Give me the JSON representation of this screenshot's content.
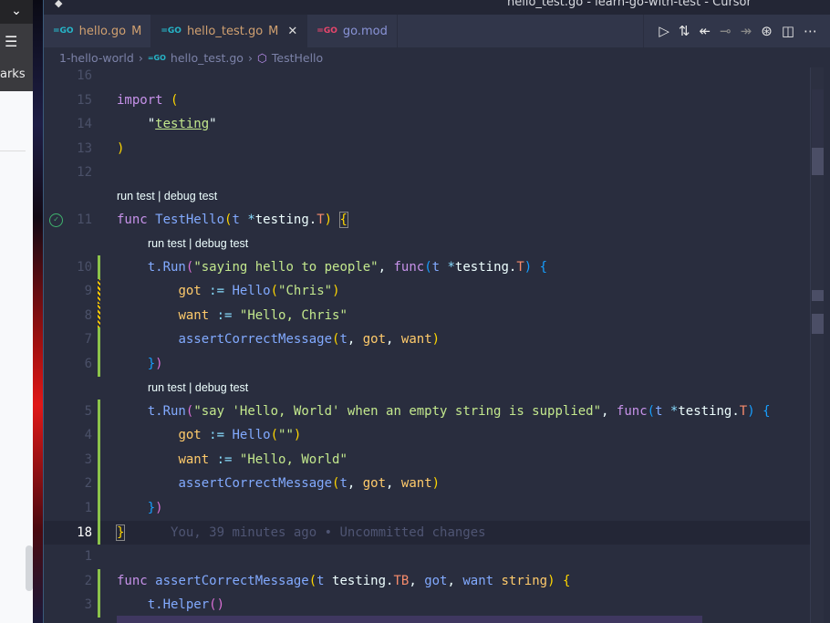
{
  "browser": {
    "label": "arks"
  },
  "window": {
    "title": "hello_test.go - learn-go-with-test - Cursor"
  },
  "tabs": [
    {
      "label": "hello.go",
      "badge": "M",
      "icon": "go-file-icon",
      "active": false
    },
    {
      "label": "hello_test.go",
      "badge": "M",
      "icon": "go-file-icon",
      "active": true
    },
    {
      "label": "go.mod",
      "badge": "",
      "icon": "go-mod-icon",
      "active": false
    }
  ],
  "actions": [
    "run-icon",
    "compare-changes-icon",
    "go-back-icon",
    "commit-icon",
    "go-forward-icon",
    "source-control-graph-icon",
    "split-editor-icon",
    "more-icon"
  ],
  "breadcrumbs": {
    "folder": "1-hello-world",
    "file": "hello_test.go",
    "symbol": "TestHello"
  },
  "lens": {
    "run": "run test",
    "sep": " | ",
    "debug": "debug test"
  },
  "blame": "You, 39 minutes ago • Uncommitted changes",
  "lines": [
    {
      "n": "16",
      "g": "",
      "t": []
    },
    {
      "n": "15",
      "g": "",
      "t": [
        [
          "kw",
          "import "
        ],
        [
          "p1",
          "("
        ]
      ]
    },
    {
      "n": "14",
      "g": "",
      "t": [
        [
          "pl",
          "    \""
        ],
        [
          "str u",
          "testing"
        ],
        [
          "pl",
          "\""
        ]
      ]
    },
    {
      "n": "13",
      "g": "",
      "t": [
        [
          "p1",
          ")"
        ]
      ]
    },
    {
      "n": "12",
      "g": "",
      "t": []
    },
    {
      "lens": true,
      "indent": 0
    },
    {
      "n": "11",
      "g": "",
      "check": true,
      "t": [
        [
          "kw",
          "func "
        ],
        [
          "fn",
          "TestHello"
        ],
        [
          "p1",
          "("
        ],
        [
          "par",
          "t "
        ],
        [
          "op",
          "*"
        ],
        [
          "pl",
          "testing."
        ],
        [
          "ty",
          "T"
        ],
        [
          "p1",
          ")"
        ],
        [
          "pl",
          " "
        ],
        [
          "p1 box",
          "{"
        ]
      ]
    },
    {
      "lens": true,
      "indent": 1
    },
    {
      "n": "10",
      "g": "add",
      "t": [
        [
          "pl",
          "    "
        ],
        [
          "fn",
          "t.Run"
        ],
        [
          "p2",
          "("
        ],
        [
          "str",
          "\"saying hello to people\""
        ],
        [
          "pl",
          ", "
        ],
        [
          "kw",
          "func"
        ],
        [
          "p3",
          "("
        ],
        [
          "par",
          "t "
        ],
        [
          "op",
          "*"
        ],
        [
          "pl",
          "testing."
        ],
        [
          "ty",
          "T"
        ],
        [
          "p3",
          ")"
        ],
        [
          "pl",
          " "
        ],
        [
          "p3",
          "{"
        ]
      ]
    },
    {
      "n": "9",
      "g": "mod",
      "t": [
        [
          "pl",
          "        "
        ],
        [
          "var",
          "got "
        ],
        [
          "op",
          ":= "
        ],
        [
          "fn",
          "Hello"
        ],
        [
          "p1",
          "("
        ],
        [
          "str",
          "\"Chris\""
        ],
        [
          "p1",
          ")"
        ]
      ]
    },
    {
      "n": "8",
      "g": "mod",
      "t": [
        [
          "pl",
          "        "
        ],
        [
          "var",
          "want "
        ],
        [
          "op",
          ":= "
        ],
        [
          "str",
          "\"Hello, Chris\""
        ]
      ]
    },
    {
      "n": "7",
      "g": "add",
      "t": [
        [
          "pl",
          "        "
        ],
        [
          "fn",
          "assertCorrectMessage"
        ],
        [
          "p1",
          "("
        ],
        [
          "par",
          "t"
        ],
        [
          "pl",
          ", "
        ],
        [
          "var",
          "got"
        ],
        [
          "pl",
          ", "
        ],
        [
          "var",
          "want"
        ],
        [
          "p1",
          ")"
        ]
      ]
    },
    {
      "n": "6",
      "g": "add",
      "t": [
        [
          "pl",
          "    "
        ],
        [
          "p3",
          "}"
        ],
        [
          "p2",
          ")"
        ]
      ]
    },
    {
      "lens": true,
      "indent": 1
    },
    {
      "n": "5",
      "g": "add",
      "t": [
        [
          "pl",
          "    "
        ],
        [
          "fn",
          "t.Run"
        ],
        [
          "p2",
          "("
        ],
        [
          "str",
          "\"say 'Hello, World' when an empty string is supplied\""
        ],
        [
          "pl",
          ", "
        ],
        [
          "kw",
          "func"
        ],
        [
          "p3",
          "("
        ],
        [
          "par",
          "t "
        ],
        [
          "op",
          "*"
        ],
        [
          "pl",
          "testing."
        ],
        [
          "ty",
          "T"
        ],
        [
          "p3",
          ")"
        ],
        [
          "pl",
          " "
        ],
        [
          "p3",
          "{"
        ]
      ]
    },
    {
      "n": "4",
      "g": "add",
      "t": [
        [
          "pl",
          "        "
        ],
        [
          "var",
          "got "
        ],
        [
          "op",
          ":= "
        ],
        [
          "fn",
          "Hello"
        ],
        [
          "p1",
          "("
        ],
        [
          "str",
          "\"\""
        ],
        [
          "p1",
          ")"
        ]
      ]
    },
    {
      "n": "3",
      "g": "add",
      "t": [
        [
          "pl",
          "        "
        ],
        [
          "var",
          "want "
        ],
        [
          "op",
          ":= "
        ],
        [
          "str",
          "\"Hello, World\""
        ]
      ]
    },
    {
      "n": "2",
      "g": "add",
      "t": [
        [
          "pl",
          "        "
        ],
        [
          "fn",
          "assertCorrectMessage"
        ],
        [
          "p1",
          "("
        ],
        [
          "par",
          "t"
        ],
        [
          "pl",
          ", "
        ],
        [
          "var",
          "got"
        ],
        [
          "pl",
          ", "
        ],
        [
          "var",
          "want"
        ],
        [
          "p1",
          ")"
        ]
      ]
    },
    {
      "n": "1",
      "g": "add",
      "t": [
        [
          "pl",
          "    "
        ],
        [
          "p3",
          "}"
        ],
        [
          "p2",
          ")"
        ]
      ]
    },
    {
      "n": "18",
      "g": "add",
      "cur": true,
      "t": [
        [
          "p1 box",
          "}"
        ],
        [
          "pl",
          "      "
        ],
        [
          "blame",
          "You, 39 minutes ago • Uncommitted changes"
        ]
      ]
    },
    {
      "n": "1",
      "g": "",
      "t": []
    },
    {
      "n": "2",
      "g": "add",
      "t": [
        [
          "kw",
          "func "
        ],
        [
          "fn",
          "assertCorrectMessage"
        ],
        [
          "p1",
          "("
        ],
        [
          "par",
          "t "
        ],
        [
          "pl",
          "testing."
        ],
        [
          "ty",
          "TB"
        ],
        [
          "pl",
          ", "
        ],
        [
          "par",
          "got"
        ],
        [
          "pl",
          ", "
        ],
        [
          "par",
          "want "
        ],
        [
          "var",
          "string"
        ],
        [
          "p1",
          ")"
        ],
        [
          "pl",
          " "
        ],
        [
          "p1",
          "{"
        ]
      ]
    },
    {
      "n": "3",
      "g": "add",
      "t": [
        [
          "pl",
          "    "
        ],
        [
          "fn",
          "t.Helper"
        ],
        [
          "p2",
          "()"
        ]
      ]
    }
  ],
  "colors": {
    "background": "#292d3e",
    "added": "#8bc34a",
    "modified": "#ffcb00",
    "keyword": "#c792ea",
    "function": "#82aaff",
    "string": "#c3e88d"
  }
}
